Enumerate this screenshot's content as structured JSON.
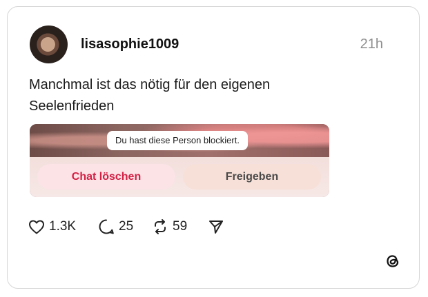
{
  "post": {
    "username": "lisasophie1009",
    "time": "21h",
    "text": "Manchmal ist das nötig für den eigenen Seelenfrieden"
  },
  "media": {
    "blocked_notice": "Du hast diese Person blockiert.",
    "delete_chat_label": "Chat löschen",
    "share_label": "Freigeben"
  },
  "actions": {
    "likes": "1.3K",
    "comments": "25",
    "reposts": "59"
  },
  "icons": {
    "like": "heart-icon",
    "comment": "comment-bubble-icon",
    "repost": "repost-icon",
    "share": "send-icon",
    "brand": "threads-logo-icon"
  },
  "colors": {
    "delete_text": "#d42045",
    "delete_bg": "#fbe3e6",
    "share_bg": "#f7e0d8",
    "muted_text": "#8e8e8e"
  }
}
